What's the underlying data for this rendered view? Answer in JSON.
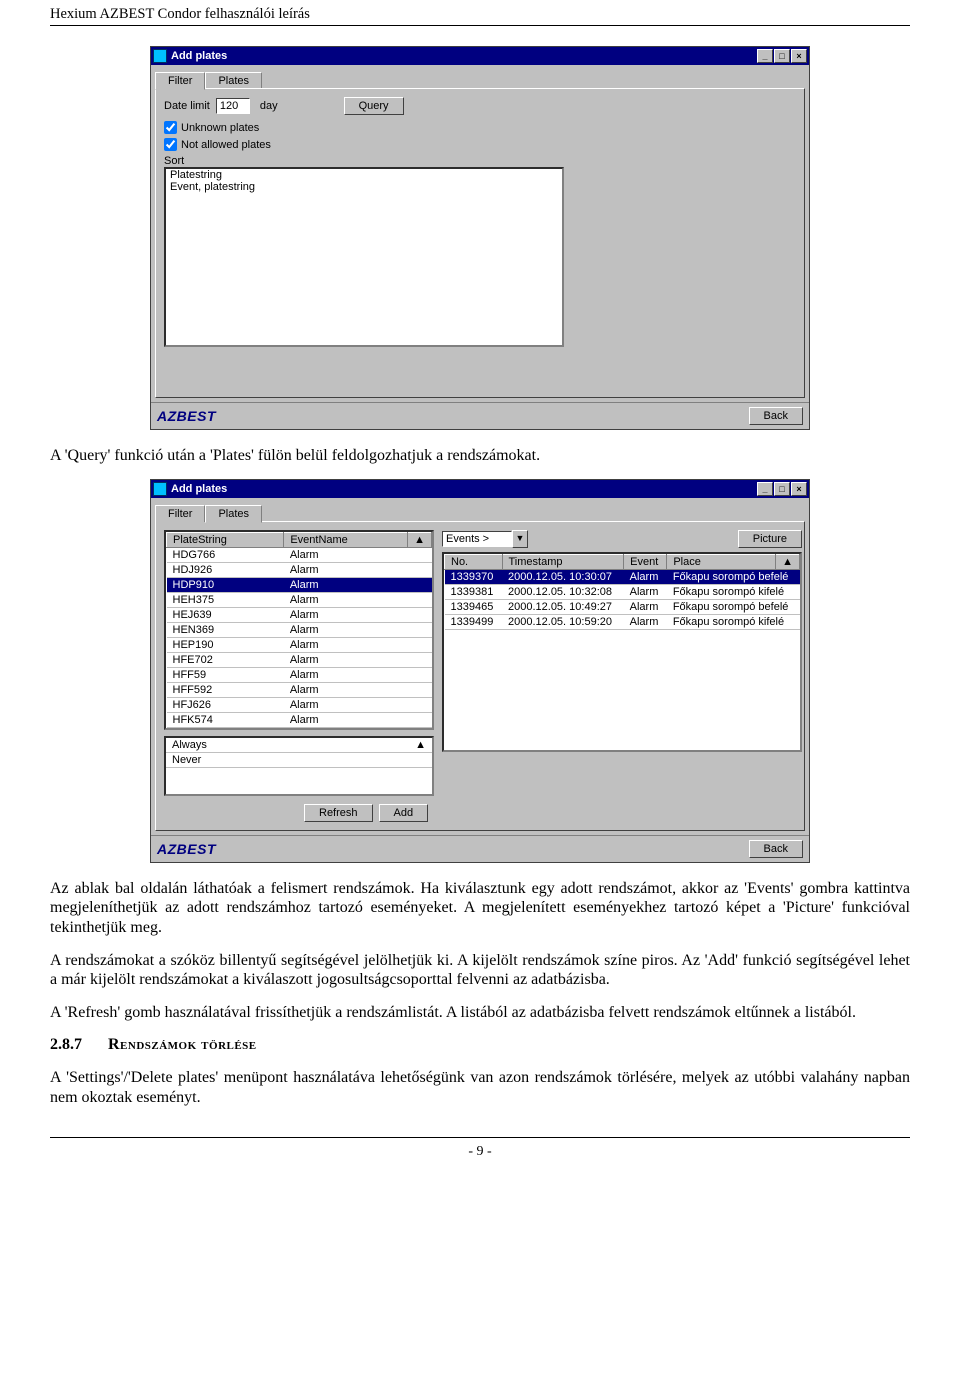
{
  "doc": {
    "header": "Hexium AZBEST Condor felhasználói leírás",
    "page_footer": "- 9 -"
  },
  "win1": {
    "title": "Add plates",
    "tabs": {
      "filter": "Filter",
      "plates": "Plates",
      "active": "Filter"
    },
    "datelimit_label": "Date limit",
    "datelimit_value": "120",
    "datelimit_unit": "day",
    "query_button": "Query",
    "unknown_plates": "Unknown plates",
    "notallowed_plates": "Not allowed plates",
    "sort_label": "Sort",
    "sort_items": [
      "Platestring",
      "Event, platestring"
    ],
    "brand": "AZBEST",
    "back_button": "Back"
  },
  "para1": "A 'Query' funkció után a 'Plates' fülön belül feldolgozhatjuk a rendszámokat.",
  "win2": {
    "title": "Add plates",
    "tabs": {
      "filter": "Filter",
      "plates": "Plates",
      "active": "Plates"
    },
    "left_headers": [
      "PlateString",
      "EventName"
    ],
    "selected_plate_index": 2,
    "plates": [
      {
        "plate": "HDG766",
        "event": "Alarm"
      },
      {
        "plate": "HDJ926",
        "event": "Alarm"
      },
      {
        "plate": "HDP910",
        "event": "Alarm"
      },
      {
        "plate": "HEH375",
        "event": "Alarm"
      },
      {
        "plate": "HEJ639",
        "event": "Alarm"
      },
      {
        "plate": "HEN369",
        "event": "Alarm"
      },
      {
        "plate": "HEP190",
        "event": "Alarm"
      },
      {
        "plate": "HFE702",
        "event": "Alarm"
      },
      {
        "plate": "HFF59",
        "event": "Alarm"
      },
      {
        "plate": "HFF592",
        "event": "Alarm"
      },
      {
        "plate": "HFJ626",
        "event": "Alarm"
      },
      {
        "plate": "HFK574",
        "event": "Alarm"
      }
    ],
    "events_combo_label": "Events >",
    "right_headers": [
      "No.",
      "Timestamp",
      "Event",
      "Place"
    ],
    "selected_event_index": 0,
    "events": [
      {
        "no": "1339370",
        "ts": "2000.12.05. 10:30:07",
        "ev": "Alarm",
        "place": "Főkapu sorompó befelé"
      },
      {
        "no": "1339381",
        "ts": "2000.12.05. 10:32:08",
        "ev": "Alarm",
        "place": "Főkapu sorompó kifelé"
      },
      {
        "no": "1339465",
        "ts": "2000.12.05. 10:49:27",
        "ev": "Alarm",
        "place": "Főkapu sorompó befelé"
      },
      {
        "no": "1339499",
        "ts": "2000.12.05. 10:59:20",
        "ev": "Alarm",
        "place": "Főkapu sorompó kifelé"
      }
    ],
    "picture_button": "Picture",
    "rules": [
      "Always",
      "Never"
    ],
    "refresh_button": "Refresh",
    "add_button": "Add",
    "brand": "AZBEST",
    "back_button": "Back"
  },
  "para2": "Az ablak bal oldalán láthatóak a felismert rendszámok. Ha kiválasztunk egy adott rendszámot, akkor az 'Events' gombra kattintva megjeleníthetjük az adott rendszámhoz tartozó eseményeket. A megjelenített eseményekhez tartozó képet a 'Picture' funkcióval tekinthetjük meg.",
  "para3": "A rendszámokat a szóköz billentyű segítségével jelölhetjük ki. A kijelölt rendszámok színe piros. Az 'Add' funkció segítségével lehet a már kijelölt rendszámokat a kiválaszott jogosultságcsoporttal felvenni az adatbázisba.",
  "para4": "A 'Refresh' gomb használatával frissíthetjük a rendszámlistát. A listából az adatbázisba felvett rendszámok eltűnnek a listából.",
  "section": {
    "num": "2.8.7",
    "title": "Rendszámok törlése"
  },
  "para5": "A 'Settings'/'Delete plates' menüpont használatáva lehetőségünk van azon rendszámok törlésére, melyek az utóbbi valahány napban nem okoztak eseményt."
}
